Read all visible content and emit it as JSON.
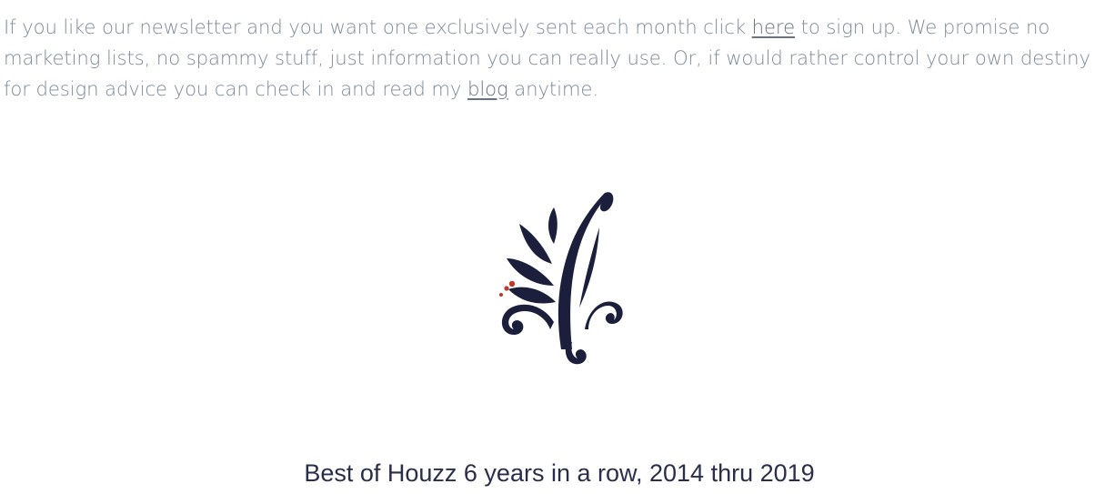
{
  "intro": {
    "text_1": "If you like our newsletter and you want one exclusively sent each month click ",
    "link_here": "here",
    "text_2": " to sign up.  We promise no marketing lists, no spammy stuff, just information you can really use.  Or, if would rather control your own destiny for design advice you can check in and read my ",
    "link_blog": "blog",
    "text_3": " anytime."
  },
  "logo": {
    "icon": "botanical-leaf-ornament-icon",
    "primary_color": "#1b1f3b",
    "accent_color": "#c0392b"
  },
  "award": {
    "text": "Best of Houzz 6 years in a row, 2014 thru 2019"
  },
  "colors": {
    "body_text": "#7f8a9a",
    "link": "#6b7380",
    "heading": "#2a2e4a"
  }
}
